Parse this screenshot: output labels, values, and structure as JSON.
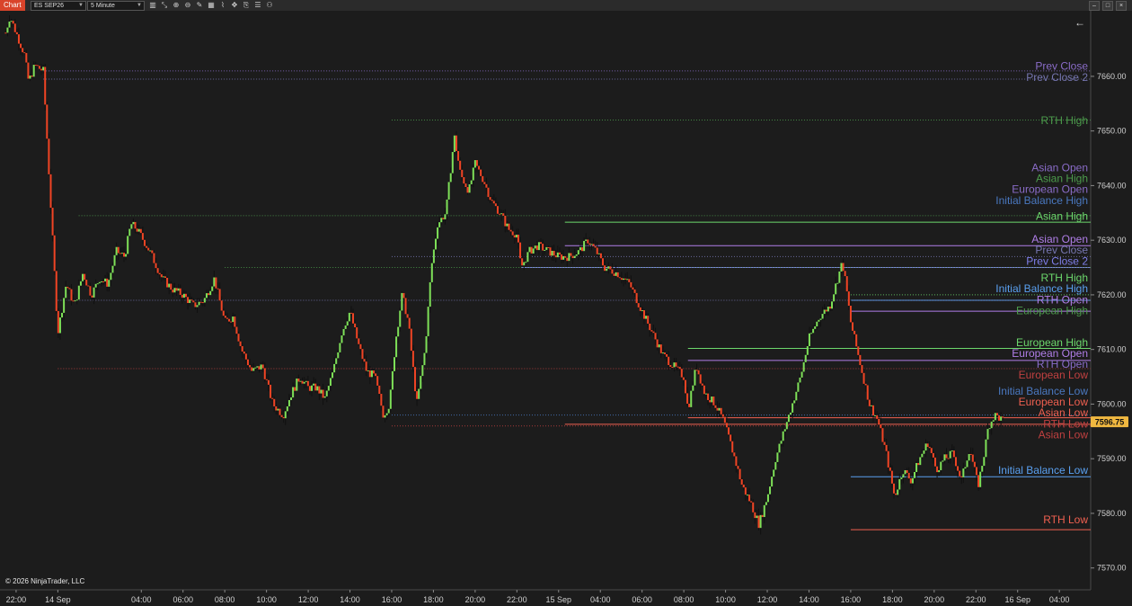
{
  "toolbar": {
    "chart_label": "Chart",
    "instrument": "ES SEP26",
    "timeframe": "5 Minute"
  },
  "copyright": "© 2026 NinjaTrader, LLC",
  "colors": {
    "background": "#1c1c1c",
    "up_bar": "#7ee058",
    "down_bar": "#f04424",
    "wick": "#101010",
    "axis_text": "#d0d0d0",
    "price_marker": "#f0b840"
  },
  "chart_data": {
    "type": "candlestick",
    "instrument": "ES SEP26",
    "interval": "5 Minute",
    "ylim": [
      7566,
      7672
    ],
    "y_ticks": [
      7660,
      7650,
      7640,
      7630,
      7620,
      7610,
      7600,
      7590,
      7580,
      7570
    ],
    "y_tick_labels": [
      "7660.00",
      "7650.00",
      "7640.00",
      "7630.00",
      "7620.00",
      "7610.00",
      "7600.00",
      "7590.00",
      "7580.00",
      "7570.00"
    ],
    "x_ticks": [
      {
        "t": 0,
        "label": "22:00"
      },
      {
        "t": 2,
        "label": "14 Sep"
      },
      {
        "t": 6,
        "label": "04:00"
      },
      {
        "t": 8,
        "label": "06:00"
      },
      {
        "t": 10,
        "label": "08:00"
      },
      {
        "t": 12,
        "label": "10:00"
      },
      {
        "t": 14,
        "label": "12:00"
      },
      {
        "t": 16,
        "label": "14:00"
      },
      {
        "t": 18,
        "label": "16:00"
      },
      {
        "t": 20,
        "label": "18:00"
      },
      {
        "t": 22,
        "label": "20:00"
      },
      {
        "t": 24,
        "label": "22:00"
      },
      {
        "t": 26,
        "label": "15 Sep"
      },
      {
        "t": 28,
        "label": "04:00"
      },
      {
        "t": 30,
        "label": "06:00"
      },
      {
        "t": 32,
        "label": "08:00"
      },
      {
        "t": 34,
        "label": "10:00"
      },
      {
        "t": 36,
        "label": "12:00"
      },
      {
        "t": 38,
        "label": "14:00"
      },
      {
        "t": 40,
        "label": "16:00"
      },
      {
        "t": 42,
        "label": "18:00"
      },
      {
        "t": 44,
        "label": "20:00"
      },
      {
        "t": 46,
        "label": "22:00"
      },
      {
        "t": 48,
        "label": "16 Sep"
      },
      {
        "t": 50,
        "label": "04:00"
      }
    ],
    "x_range": [
      -0.6,
      51.5
    ],
    "last_price": 7596.75,
    "last_price_label": "7596.75",
    "price_path": [
      [
        -0.5,
        7668
      ],
      [
        -0.3,
        7671
      ],
      [
        0,
        7668
      ],
      [
        0.4,
        7664
      ],
      [
        0.6,
        7659
      ],
      [
        0.9,
        7662
      ],
      [
        1.3,
        7661
      ],
      [
        2,
        7613
      ],
      [
        2.4,
        7622
      ],
      [
        2.8,
        7618
      ],
      [
        3.2,
        7624
      ],
      [
        3.6,
        7620
      ],
      [
        4,
        7623
      ],
      [
        4.4,
        7622
      ],
      [
        4.8,
        7628
      ],
      [
        5.2,
        7627
      ],
      [
        5.5,
        7633
      ],
      [
        5.8,
        7632
      ],
      [
        6.4,
        7628
      ],
      [
        7,
        7623
      ],
      [
        7.5,
        7621
      ],
      [
        8,
        7620
      ],
      [
        8.5,
        7618
      ],
      [
        9,
        7619
      ],
      [
        9.5,
        7623
      ],
      [
        10,
        7615
      ],
      [
        10.4,
        7616
      ],
      [
        10.8,
        7610
      ],
      [
        11.3,
        7606
      ],
      [
        11.8,
        7607
      ],
      [
        12.3,
        7600
      ],
      [
        12.8,
        7598
      ],
      [
        13.2,
        7602
      ],
      [
        13.6,
        7605
      ],
      [
        14,
        7603
      ],
      [
        14.4,
        7603
      ],
      [
        14.8,
        7601
      ],
      [
        15.2,
        7606
      ],
      [
        15.6,
        7613
      ],
      [
        16,
        7617
      ],
      [
        16.4,
        7611
      ],
      [
        16.8,
        7606
      ],
      [
        17.2,
        7605
      ],
      [
        17.6,
        7598
      ],
      [
        17.9,
        7600
      ],
      [
        18.2,
        7612
      ],
      [
        18.5,
        7620
      ],
      [
        18.8,
        7615
      ],
      [
        19.2,
        7600
      ],
      [
        19.6,
        7610
      ],
      [
        19.9,
        7625
      ],
      [
        20.2,
        7633
      ],
      [
        20.6,
        7635
      ],
      [
        21,
        7649
      ],
      [
        21.3,
        7642
      ],
      [
        21.7,
        7639
      ],
      [
        22,
        7644
      ],
      [
        22.4,
        7641
      ],
      [
        22.8,
        7637
      ],
      [
        23.2,
        7635
      ],
      [
        23.6,
        7632
      ],
      [
        24,
        7631
      ],
      [
        24.2,
        7625
      ],
      [
        24.6,
        7628
      ],
      [
        25,
        7629
      ],
      [
        25.5,
        7628
      ],
      [
        26,
        7627
      ],
      [
        26.5,
        7627
      ],
      [
        27,
        7628
      ],
      [
        27.4,
        7630
      ],
      [
        27.8,
        7628
      ],
      [
        28.2,
        7625
      ],
      [
        28.8,
        7624
      ],
      [
        29.4,
        7622
      ],
      [
        30,
        7617
      ],
      [
        30.5,
        7613
      ],
      [
        31,
        7609
      ],
      [
        31.5,
        7607
      ],
      [
        32,
        7605
      ],
      [
        32.2,
        7599
      ],
      [
        32.6,
        7607
      ],
      [
        33,
        7602
      ],
      [
        33.5,
        7600
      ],
      [
        33.9,
        7597
      ],
      [
        34.3,
        7592
      ],
      [
        34.8,
        7585
      ],
      [
        35.2,
        7582
      ],
      [
        35.6,
        7578
      ],
      [
        36,
        7583
      ],
      [
        36.4,
        7590
      ],
      [
        36.8,
        7595
      ],
      [
        37.2,
        7600
      ],
      [
        37.6,
        7605
      ],
      [
        38,
        7612
      ],
      [
        38.5,
        7616
      ],
      [
        39,
        7618
      ],
      [
        39.3,
        7622
      ],
      [
        39.6,
        7626
      ],
      [
        39.8,
        7621
      ],
      [
        40,
        7615
      ],
      [
        40.3,
        7610
      ],
      [
        40.6,
        7605
      ],
      [
        40.9,
        7600
      ],
      [
        41.3,
        7597
      ],
      [
        41.7,
        7591
      ],
      [
        42.1,
        7583
      ],
      [
        42.5,
        7588
      ],
      [
        42.9,
        7586
      ],
      [
        43.3,
        7590
      ],
      [
        43.7,
        7593
      ],
      [
        44.1,
        7588
      ],
      [
        44.5,
        7590
      ],
      [
        44.9,
        7591
      ],
      [
        45.3,
        7586
      ],
      [
        45.7,
        7592
      ],
      [
        46.1,
        7585
      ],
      [
        46.4,
        7591
      ],
      [
        46.6,
        7596
      ],
      [
        46.9,
        7598
      ],
      [
        47.3,
        7597
      ]
    ],
    "levels": [
      {
        "label": "Prev Close",
        "price": 7661,
        "t0": 1.3,
        "color": "#8a6cc8",
        "style": "dotted",
        "label_price": 7661.9
      },
      {
        "label": "Prev Close 2",
        "price": 7659.5,
        "t0": 1.3,
        "color": "#7676b0",
        "style": "dotted",
        "label_price": 7659.8
      },
      {
        "label": "RTH High",
        "price": 7652,
        "t0": 18,
        "color": "#4c9c4c",
        "style": "dotted",
        "label_price": 7651.9
      },
      {
        "label": "Asian Open",
        "price": null,
        "color": "#8a6cc8",
        "label_price": 7643.3
      },
      {
        "label": "Asian High",
        "price": 7634.5,
        "t0": 3,
        "color": "#4c9c4c",
        "style": "dotted",
        "label_price": 7641.3
      },
      {
        "label": "European Open",
        "price": null,
        "color": "#8a6cc8",
        "label_price": 7639.3
      },
      {
        "label": "Initial Balance High",
        "price": null,
        "color": "#4a78c0",
        "label_price": 7637.3
      },
      {
        "label": "Asian High",
        "price": 7633.3,
        "t0": 26.3,
        "color": "#6cd86c",
        "style": "solid",
        "label_price": 7634.4
      },
      {
        "label": "Asian Open",
        "price": 7629,
        "t0": 26.3,
        "color": "#b07ee8",
        "style": "solid",
        "label_price": 7630.2
      },
      {
        "label": "Prev Close",
        "price": 7627,
        "t0": 18,
        "color": "#7676b0",
        "style": "dotted",
        "label_price": 7628.2
      },
      {
        "label": "Prev Close 2",
        "price": 7625,
        "t0": 24.2,
        "color": "#7e7ee8",
        "style": "solid",
        "label_price": 7626.2
      },
      {
        "label": "Prev Close 2",
        "price": 7625,
        "t0": 10,
        "color": "#4c9c4c",
        "style": "dotted",
        "label_price": null
      },
      {
        "label": "RTH High",
        "price": 7620,
        "t0": 40,
        "color": "#6cd86c",
        "style": "dotted",
        "label_price": 7623.1
      },
      {
        "label": "Initial Balance High",
        "price": 7619,
        "t0": 40,
        "color": "#5aa0f0",
        "style": "solid",
        "label_price": 7621.1
      },
      {
        "label": "RTH Open",
        "price": 7617,
        "t0": 40,
        "color": "#b07ee8",
        "style": "solid",
        "label_price": 7619.1
      },
      {
        "label": "European High",
        "price": null,
        "color": "#4c9c4c",
        "label_price": 7617.1
      },
      {
        "label": "RTH Open",
        "price": 7619,
        "t0": 2,
        "color": "#7676b0",
        "style": "dotted",
        "label_price": null
      },
      {
        "label": "European High",
        "price": 7610.2,
        "t0": 32.2,
        "color": "#6cd86c",
        "style": "solid",
        "label_price": 7611.3
      },
      {
        "label": "European Open",
        "price": 7608,
        "t0": 32.2,
        "color": "#b07ee8",
        "style": "solid",
        "label_price": 7609.3
      },
      {
        "label": "RTH Open",
        "price": null,
        "color": "#8a6cc8",
        "label_price": 7607.3
      },
      {
        "label": "European Low",
        "price": 7606.5,
        "t0": 2,
        "color": "#c04040",
        "style": "dotted",
        "label_price": 7605.3
      },
      {
        "label": "Initial Balance Low",
        "price": 7598,
        "t0": 18,
        "color": "#4a78c0",
        "style": "dotted",
        "label_price": 7602.4
      },
      {
        "label": "European Low",
        "price": 7597.5,
        "t0": 32.2,
        "color": "#f06050",
        "style": "solid",
        "label_price": 7600.4
      },
      {
        "label": "Asian Low",
        "price": 7596.3,
        "t0": 26.3,
        "color": "#f06050",
        "style": "solid",
        "label_price": 7598.4
      },
      {
        "label": "RTH Low",
        "price": 7596,
        "t0": 18,
        "color": "#c04040",
        "style": "dotted",
        "label_price": 7596.4
      },
      {
        "label": "Asian Low",
        "price": null,
        "color": "#c04040",
        "label_price": 7594.4
      },
      {
        "label": "Initial Balance Low",
        "price": 7586.7,
        "t0": 40,
        "color": "#5aa0f0",
        "style": "solid",
        "label_price": 7587.9
      },
      {
        "label": "RTH Low",
        "price": 7577,
        "t0": 40,
        "color": "#f06050",
        "style": "solid",
        "label_price": 7578.8
      }
    ]
  }
}
